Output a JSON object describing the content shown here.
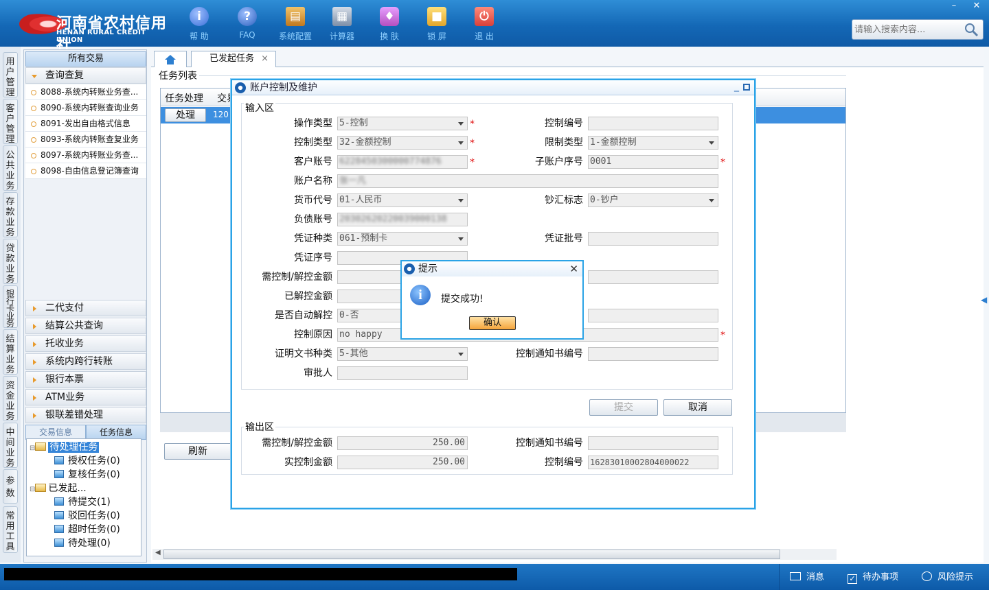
{
  "brand": {
    "name_cn": "河南省农村信用社",
    "name_en": "HENAN RURAL CREDIT UNION",
    "colors": {
      "header": "#1468b6",
      "accent": "#2aa3e6",
      "required": "#e01010"
    }
  },
  "toolbar": [
    {
      "label": "帮 助",
      "icon": "info-icon",
      "color": "#3a6fd8"
    },
    {
      "label": "FAQ",
      "icon": "question-icon",
      "color": "#2a5fbd"
    },
    {
      "label": "系统配置",
      "icon": "toolbox-icon",
      "color": "#d08a28"
    },
    {
      "label": "计算器",
      "icon": "calculator-icon",
      "color": "#7d8fa8"
    },
    {
      "label": "换 肤",
      "icon": "shirt-icon",
      "color": "#b34fc0"
    },
    {
      "label": "锁 屏",
      "icon": "lock-icon",
      "color": "#e2a62b"
    },
    {
      "label": "退 出",
      "icon": "power-icon",
      "color": "#d8403a"
    }
  ],
  "search": {
    "placeholder": "请输入搜索内容..."
  },
  "window": {
    "minimize": "–",
    "close": "✕"
  },
  "vtabs": [
    "用户管理",
    "客户管理",
    "公共业务",
    "存款业务",
    "贷款业务",
    "银行卡业务",
    "结算业务",
    "资金业务",
    "中间业务",
    "参数",
    "常用工具"
  ],
  "side": {
    "title": "所有交易",
    "open_category": "查询查复",
    "items": [
      "8088-系统内转账业务查...",
      "8090-系统内转账查询业务",
      "8091-发出自由格式信息",
      "8093-系统内转账查复业务",
      "8097-系统内转账业务查...",
      "8098-自由信息登记簿查询"
    ],
    "categories": [
      "二代支付",
      "结算公共查询",
      "托收业务",
      "系统内跨行转账",
      "银行本票",
      "ATM业务",
      "银联差错处理"
    ],
    "info_tabs": [
      "交易信息",
      "任务信息"
    ],
    "tree": {
      "pending": "待处理任务",
      "pending_children": [
        "授权任务(0)",
        "复核任务(0)"
      ],
      "initiated": "已发起...",
      "initiated_children": [
        "待提交(1)",
        "驳回任务(0)",
        "超时任务(0)",
        "待处理(0)"
      ]
    }
  },
  "tabs": {
    "active": "已发起任务",
    "close": "×"
  },
  "tasklist": {
    "title": "任务列表",
    "col_action": "任务处理",
    "col_trade": "交易",
    "row_button": "处理",
    "row_value": "120",
    "refresh": "刷新"
  },
  "dialog": {
    "title": "账户控制及维护",
    "input_section": "输入区",
    "output_section": "输出区",
    "fields": {
      "op_type": {
        "label": "操作类型",
        "value": "5-控制"
      },
      "ctrl_no": {
        "label": "控制编号",
        "value": ""
      },
      "ctrl_type": {
        "label": "控制类型",
        "value": "32-金额控制"
      },
      "limit_type": {
        "label": "限制类型",
        "value": "1-金额控制"
      },
      "cust_acct": {
        "label": "客户账号",
        "value": "6228450300000774876"
      },
      "sub_seq": {
        "label": "子账户序号",
        "value": "0001"
      },
      "acct_name": {
        "label": "账户名称",
        "value": "张一凡"
      },
      "currency": {
        "label": "货币代号",
        "value": "01-人民币"
      },
      "cash_flag": {
        "label": "钞汇标志",
        "value": "0-钞户"
      },
      "debt_acct": {
        "label": "负债账号",
        "value": "20302620220039000138"
      },
      "voucher_type": {
        "label": "凭证种类",
        "value": "061-预制卡"
      },
      "voucher_batch": {
        "label": "凭证批号",
        "value": ""
      },
      "voucher_seq": {
        "label": "凭证序号",
        "value": ""
      },
      "amount": {
        "label": "需控制/解控金额",
        "value": ""
      },
      "unfrozen": {
        "label": "已解控金额",
        "value": ""
      },
      "auto_release": {
        "label": "是否自动解控",
        "value": "0-否"
      },
      "reason": {
        "label": "控制原因",
        "value": "no happy"
      },
      "doc_type": {
        "label": "证明文书种类",
        "value": "5-其他"
      },
      "notice_no": {
        "label": "控制通知书编号",
        "value": ""
      },
      "approver": {
        "label": "审批人",
        "value": ""
      }
    },
    "submit": "提交",
    "cancel": "取消",
    "output": {
      "amount": {
        "label": "需控制/解控金额",
        "value": "250.00"
      },
      "notice_no": {
        "label": "控制通知书编号",
        "value": ""
      },
      "actual": {
        "label": "实控制金额",
        "value": "250.00"
      },
      "ctrl_no": {
        "label": "控制编号",
        "value": "16283010002804000022"
      }
    }
  },
  "alert": {
    "title": "提示",
    "message": "提交成功!",
    "ok": "确认"
  },
  "status": {
    "message": "消息",
    "todo": "待办事项",
    "risk": "风险提示"
  }
}
